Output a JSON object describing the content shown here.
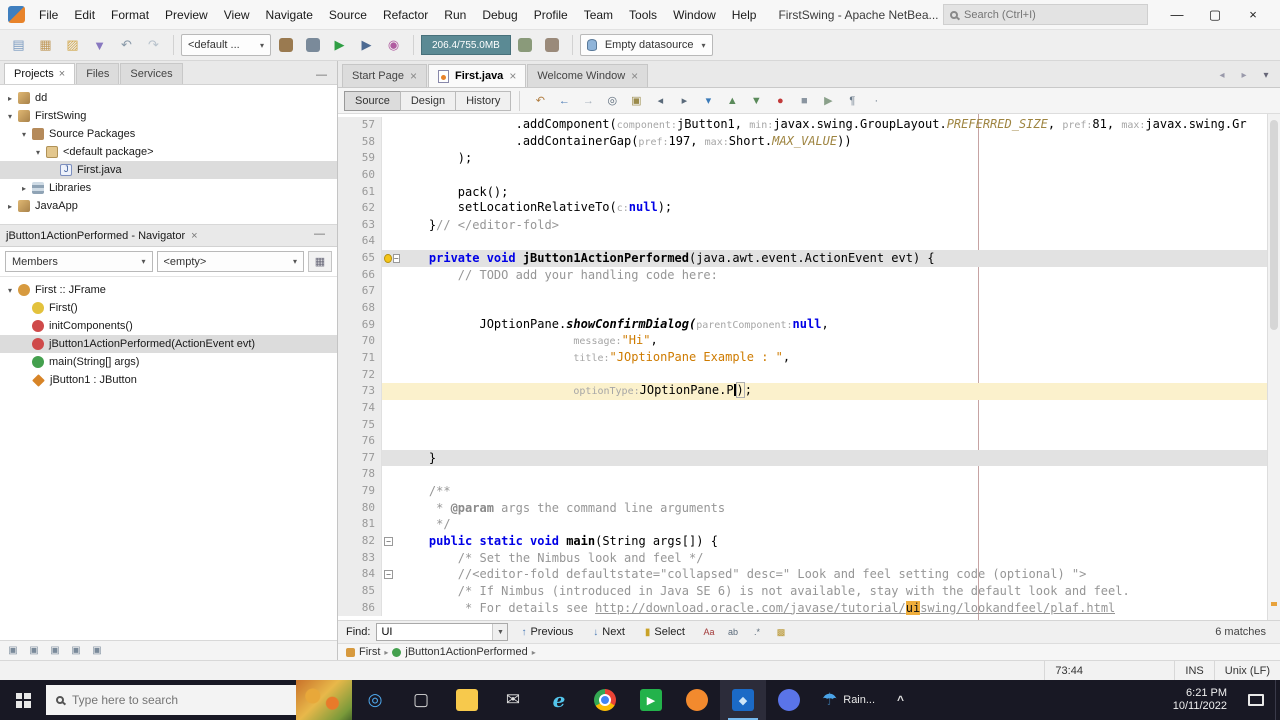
{
  "window": {
    "title": "FirstSwing - Apache NetBea...",
    "search_placeholder": "Search (Ctrl+I)",
    "controls": {
      "minimize": "—",
      "maximize": "▢",
      "close": "×"
    }
  },
  "menubar": [
    "File",
    "Edit",
    "Format",
    "Preview",
    "View",
    "Navigate",
    "Source",
    "Refactor",
    "Run",
    "Debug",
    "Profile",
    "Team",
    "Tools",
    "Window",
    "Help"
  ],
  "toolbar": {
    "file_icons": [
      {
        "name": "new-file-icon",
        "g": "▤",
        "c": "#7a9ac0"
      },
      {
        "name": "new-project-icon",
        "g": "▦",
        "c": "#c0995a"
      },
      {
        "name": "open-project-icon",
        "g": "▨",
        "c": "#d2a84e"
      },
      {
        "name": "save-all-icon",
        "g": "▼",
        "c": "#8878c0"
      },
      {
        "name": "undo-icon",
        "g": "↶",
        "c": "#8898a8"
      },
      {
        "name": "redo-icon",
        "g": "↷",
        "c": "#b8c2cc"
      }
    ],
    "config_value": "<default ...",
    "build_icons": [
      {
        "name": "build-project-icon",
        "box": "#9a7a50"
      },
      {
        "name": "clean-build-project-icon",
        "box": "#7a8a9a"
      }
    ],
    "run_icons": [
      {
        "name": "run-project-icon",
        "g": "▶",
        "c": "#2f9e44"
      },
      {
        "name": "debug-project-icon",
        "g": "▶",
        "c": "#4c6a92"
      },
      {
        "name": "profile-project-icon",
        "g": "◉",
        "c": "#b05ca0"
      }
    ],
    "memory": "206.4/755.0MB",
    "gc_icons": [
      {
        "name": "run-gc-icon",
        "box": "#8a9a7a"
      },
      {
        "name": "heap-dump-icon",
        "box": "#9a8a7a"
      }
    ],
    "datasource_value": "Empty datasource"
  },
  "left": {
    "tabs": [
      {
        "label": "Projects",
        "active": true,
        "closable": true
      },
      {
        "label": "Files",
        "active": false,
        "closable": false
      },
      {
        "label": "Services",
        "active": false,
        "closable": false
      }
    ],
    "project_tree": [
      {
        "label": "dd",
        "depth": 0,
        "exp": "▸",
        "icon": "project"
      },
      {
        "label": "FirstSwing",
        "depth": 0,
        "exp": "▾",
        "icon": "project"
      },
      {
        "label": "Source Packages",
        "depth": 1,
        "exp": "▾",
        "icon": "pkgroot"
      },
      {
        "label": "<default package>",
        "depth": 2,
        "exp": "▾",
        "icon": "package"
      },
      {
        "label": "First.java",
        "depth": 3,
        "exp": "",
        "icon": "java",
        "selected": true
      },
      {
        "label": "Libraries",
        "depth": 1,
        "exp": "▸",
        "icon": "libraries"
      },
      {
        "label": "JavaApp",
        "depth": 0,
        "exp": "▸",
        "icon": "project"
      }
    ],
    "navigator": {
      "title": "jButton1ActionPerformed - Navigator",
      "members_label": "Members",
      "filter_value": "<empty>",
      "tree": [
        {
          "label": "First :: JFrame",
          "depth": 0,
          "exp": "▾",
          "icon": "class"
        },
        {
          "label": "First()",
          "depth": 1,
          "exp": "",
          "icon": "constructor"
        },
        {
          "label": "initComponents()",
          "depth": 1,
          "exp": "",
          "icon": "private-method"
        },
        {
          "label": "jButton1ActionPerformed(ActionEvent evt)",
          "depth": 1,
          "exp": "",
          "icon": "private-method",
          "selected": true
        },
        {
          "label": "main(String[] args)",
          "depth": 1,
          "exp": "",
          "icon": "static-method"
        },
        {
          "label": "jButton1 : JButton",
          "depth": 1,
          "exp": "",
          "icon": "field"
        }
      ]
    },
    "mini_toolbar": [
      {
        "name": "output-window-icon",
        "g": "▣",
        "c": "#7a8a9a"
      },
      {
        "name": "notifications-window-icon",
        "g": "▣",
        "c": "#7a8a9a"
      },
      {
        "name": "tasks-window-icon",
        "g": "▣",
        "c": "#7a8a9a"
      },
      {
        "name": "search-results-window-icon",
        "g": "▣",
        "c": "#7a8a9a"
      },
      {
        "name": "terminal-window-icon",
        "g": "▣",
        "c": "#7a8a9a"
      }
    ]
  },
  "editor": {
    "tabs": [
      {
        "label": "Start Page",
        "active": false
      },
      {
        "label": "First.java",
        "active": true,
        "icon": "java-file"
      },
      {
        "label": "Welcome Window",
        "active": false
      }
    ],
    "tabrow_icons": [
      {
        "name": "scroll-tabs-left-icon",
        "g": "◂",
        "c": "#99a"
      },
      {
        "name": "scroll-tabs-right-icon",
        "g": "▸",
        "c": "#99a"
      },
      {
        "name": "tab-list-icon",
        "g": "▾",
        "c": "#667"
      }
    ],
    "view_buttons": [
      {
        "label": "Source",
        "active": true
      },
      {
        "label": "Design",
        "active": false
      },
      {
        "label": "History",
        "active": false
      }
    ],
    "toolbar_icons": [
      {
        "name": "last-edit-icon",
        "g": "↶",
        "c": "#b07c3f"
      },
      {
        "name": "back-icon",
        "g": "←",
        "c": "#4a7ab5"
      },
      {
        "name": "forward-icon",
        "g": "→",
        "c": "#a9b3be"
      },
      {
        "name": "find-selection-icon",
        "g": "◎",
        "c": "#5a6a7a"
      },
      {
        "name": "highlight-occurrences-icon",
        "g": "▣",
        "c": "#9a8a4a"
      },
      {
        "name": "previous-bookmark-icon",
        "g": "◂",
        "c": "#5a6a7a"
      },
      {
        "name": "next-bookmark-icon",
        "g": "▸",
        "c": "#5a6a7a"
      },
      {
        "name": "toggle-bookmark-icon",
        "g": "▾",
        "c": "#3a7ab8"
      },
      {
        "name": "previous-occurrence-icon",
        "g": "▲",
        "c": "#5a8a5a"
      },
      {
        "name": "next-occurrence-icon",
        "g": "▼",
        "c": "#5a8a5a"
      },
      {
        "name": "toggle-breakpoint-icon",
        "g": "●",
        "c": "#c23a3a"
      },
      {
        "name": "stop-macro-icon",
        "g": "■",
        "c": "#8a95a0"
      },
      {
        "name": "start-macro-icon",
        "g": "▶",
        "c": "#8aa08a"
      },
      {
        "name": "comment-lines-icon",
        "g": "¶",
        "c": "#6a7a8a"
      },
      {
        "name": "uncomment-lines-icon",
        "g": "·",
        "c": "#6a7a8a"
      }
    ],
    "lines": [
      {
        "n": 57,
        "segs": [
          [
            "p",
            "                .addComponent("
          ],
          [
            "h",
            "component:"
          ],
          [
            "p",
            "jButton1, "
          ],
          [
            "h",
            "min:"
          ],
          [
            "p",
            "javax.swing.GroupLayout."
          ],
          [
            "f",
            "PREFERRED_SIZE"
          ],
          [
            "p",
            ", "
          ],
          [
            "h",
            "pref:"
          ],
          [
            "p",
            "81, "
          ],
          [
            "h",
            "max:"
          ],
          [
            "p",
            "javax.swing.Gr"
          ]
        ]
      },
      {
        "n": 58,
        "segs": [
          [
            "p",
            "                .addContainerGap("
          ],
          [
            "h",
            "pref:"
          ],
          [
            "p",
            "197, "
          ],
          [
            "h",
            "max:"
          ],
          [
            "p",
            "Short."
          ],
          [
            "f",
            "MAX_VALUE"
          ],
          [
            "p",
            "))"
          ]
        ]
      },
      {
        "n": 59,
        "segs": [
          [
            "p",
            "        );"
          ]
        ]
      },
      {
        "n": 60,
        "segs": []
      },
      {
        "n": 61,
        "segs": [
          [
            "p",
            "        pack();"
          ]
        ]
      },
      {
        "n": 62,
        "segs": [
          [
            "p",
            "        setLocationRelativeTo("
          ],
          [
            "h",
            "c:"
          ],
          [
            "k",
            "null"
          ],
          [
            "p",
            ");"
          ]
        ]
      },
      {
        "n": 63,
        "segs": [
          [
            "p",
            "    }"
          ],
          [
            "c",
            "// </editor-fold>"
          ]
        ]
      },
      {
        "n": 64,
        "segs": []
      },
      {
        "n": 65,
        "hl": "band",
        "bulb": true,
        "fold": true,
        "segs": [
          [
            "p",
            "    "
          ],
          [
            "k",
            "private void "
          ],
          [
            "m",
            "jButton1ActionPerformed"
          ],
          [
            "p",
            "(java.awt.event.ActionEvent evt) {"
          ]
        ]
      },
      {
        "n": 66,
        "segs": [
          [
            "c",
            "        // TODO add your handling code here:"
          ]
        ]
      },
      {
        "n": 67,
        "segs": []
      },
      {
        "n": 68,
        "segs": []
      },
      {
        "n": 69,
        "segs": [
          [
            "p",
            "           JOptionPane."
          ],
          [
            "sm",
            "showConfirmDialog("
          ],
          [
            "h",
            "parentComponent:"
          ],
          [
            "k",
            "null"
          ],
          [
            "p",
            ","
          ]
        ]
      },
      {
        "n": 70,
        "segs": [
          [
            "p",
            "                        "
          ],
          [
            "h",
            "message:"
          ],
          [
            "s",
            "\"Hi\""
          ],
          [
            "p",
            ","
          ]
        ]
      },
      {
        "n": 71,
        "segs": [
          [
            "p",
            "                        "
          ],
          [
            "h",
            "title:"
          ],
          [
            "s",
            "\"JOptionPane Example : \""
          ],
          [
            "p",
            ","
          ]
        ]
      },
      {
        "n": 72,
        "segs": []
      },
      {
        "n": 73,
        "hl": "current",
        "segs": [
          [
            "p",
            "                        "
          ],
          [
            "h",
            "optionType:"
          ],
          [
            "p",
            "JOptionPane.P"
          ],
          [
            "caret",
            ""
          ],
          [
            "pm",
            ")"
          ],
          [
            "p",
            ";"
          ]
        ]
      },
      {
        "n": 74,
        "segs": []
      },
      {
        "n": 75,
        "segs": []
      },
      {
        "n": 76,
        "segs": []
      },
      {
        "n": 77,
        "hl": "band",
        "segs": [
          [
            "p",
            "    }"
          ]
        ]
      },
      {
        "n": 78,
        "segs": []
      },
      {
        "n": 79,
        "segs": [
          [
            "c",
            "    /**"
          ]
        ]
      },
      {
        "n": 80,
        "segs": [
          [
            "c",
            "     * "
          ],
          [
            "cb",
            "@param"
          ],
          [
            "c",
            " args the command line arguments"
          ]
        ]
      },
      {
        "n": 81,
        "segs": [
          [
            "c",
            "     */"
          ]
        ]
      },
      {
        "n": 82,
        "fold": true,
        "segs": [
          [
            "p",
            "    "
          ],
          [
            "k",
            "public static void "
          ],
          [
            "m",
            "main"
          ],
          [
            "p",
            "(String args[]) {"
          ]
        ]
      },
      {
        "n": 83,
        "segs": [
          [
            "c",
            "        /* Set the Nimbus look and feel */"
          ]
        ]
      },
      {
        "n": 84,
        "fold": true,
        "segs": [
          [
            "c",
            "        //<editor-fold defaultstate=\"collapsed\" desc=\" Look and feel setting code (optional) \">"
          ]
        ]
      },
      {
        "n": 85,
        "segs": [
          [
            "c",
            "        /* If Nimbus (introduced in Java SE 6) is not available, stay with the default look and feel."
          ]
        ]
      },
      {
        "n": 86,
        "segs": [
          [
            "c",
            "         * For details see "
          ],
          [
            "u",
            "http://download.oracle.com/javase/tutorial/"
          ],
          [
            "mk",
            "ui"
          ],
          [
            "u",
            "swing/lookandfeel/plaf.html"
          ]
        ]
      }
    ]
  },
  "find_bar": {
    "label": "Find:",
    "value": "UI",
    "previous": "Previous",
    "next": "Next",
    "select": "Select",
    "matches": "6 matches",
    "toggles": [
      {
        "name": "match-case-toggle",
        "g": "Aa",
        "c": "#a33a3a"
      },
      {
        "name": "whole-words-toggle",
        "g": "ab",
        "c": "#5a6a7a"
      },
      {
        "name": "regex-toggle",
        "g": ".*",
        "c": "#5a6a7a"
      },
      {
        "name": "highlight-results-toggle",
        "g": "▩",
        "c": "#b8952e"
      }
    ]
  },
  "breadcrumb": {
    "items": [
      {
        "label": "First",
        "icon": "class"
      },
      {
        "label": "jButton1ActionPerformed",
        "icon": "method"
      }
    ]
  },
  "status": {
    "caret": "73:44",
    "ins": "INS",
    "eol": "Unix (LF)"
  },
  "taskbar": {
    "search_placeholder": "Type here to search",
    "apps": [
      {
        "name": "cortana-icon",
        "g": "◎",
        "c": "#4ea6ea"
      },
      {
        "name": "task-view-icon",
        "g": "▢",
        "c": "#d8d8d8"
      },
      {
        "name": "file-explorer-icon",
        "sq": "#f7c94c"
      },
      {
        "name": "mail-icon",
        "g": "✉",
        "c": "#e0e0e0"
      },
      {
        "name": "edge-icon",
        "g": "e",
        "c": "#53c4ea"
      },
      {
        "name": "chrome-icon",
        "chrome": true
      },
      {
        "name": "line-app-icon",
        "sq": "#23b24b",
        "g": "▶",
        "c": "#ffffff"
      },
      {
        "name": "firefox-icon",
        "ball": "#f28a2e"
      },
      {
        "name": "netbeans-icon",
        "sq": "#1b6ac6",
        "g": "◆",
        "c": "#cfe6f8",
        "active": true
      },
      {
        "name": "discord-icon",
        "ball": "#5a74e8"
      }
    ],
    "weather": {
      "label": "Rain...",
      "icon": "umbrella-icon"
    },
    "tray_chevron": "^",
    "time": "6:21 PM",
    "date": "10/11/2022"
  }
}
